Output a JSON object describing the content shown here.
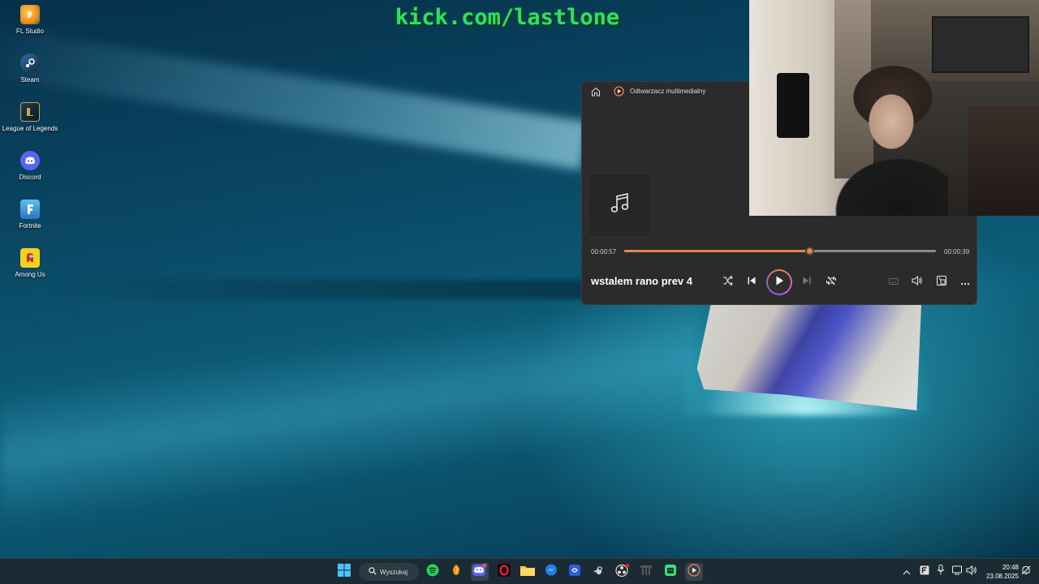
{
  "watermark": {
    "text": "kick.com/lastlone"
  },
  "desktop_icons": [
    {
      "label": "FL Studio",
      "icon": "fl-studio-icon",
      "color": "#f59a1c"
    },
    {
      "label": "Steam",
      "icon": "steam-icon",
      "color": "#1b2838"
    },
    {
      "label": "League of Legends",
      "icon": "league-of-legends-icon",
      "color": "#c8a54a"
    },
    {
      "label": "Discord",
      "icon": "discord-icon",
      "color": "#5865f2"
    },
    {
      "label": "Fortnite",
      "icon": "fortnite-icon",
      "color": "#3aa0e0"
    },
    {
      "label": "Among Us",
      "icon": "among-us-icon",
      "color": "#d02a2a"
    }
  ],
  "player": {
    "app_title": "Odtwarzacz multimedialny",
    "time_current": "00:00:57",
    "time_remaining": "00:00:39",
    "progress": 0.594,
    "song_title": "wstalem rano prev 4",
    "accent_color": "#e8814a",
    "controls": [
      "shuffle-icon",
      "previous-icon",
      "play-icon",
      "next-icon",
      "repeat-icon",
      "miniplayer-icon",
      "volume-icon",
      "compact-icon",
      "more-icon"
    ]
  },
  "taskbar": {
    "search_label": "Wyszukaj",
    "time": "20:48",
    "date": "23.08.2025",
    "apps": [
      "spotify-icon",
      "fl-studio-icon",
      "discord-icon",
      "opera-gx-icon",
      "file-explorer-icon",
      "messenger-icon",
      "app-icon",
      "steam-icon",
      "obs-icon",
      "network-icon",
      "android-icon",
      "media-player-icon"
    ]
  }
}
